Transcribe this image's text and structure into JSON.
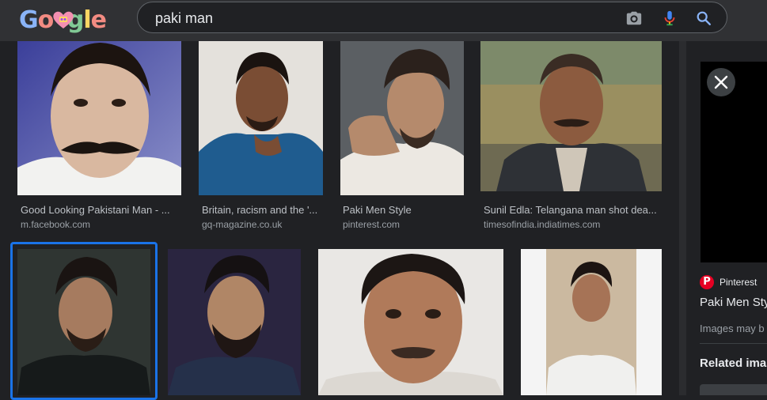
{
  "logo": {
    "letters": [
      "G",
      "o",
      "g",
      "l",
      "e"
    ]
  },
  "search": {
    "query": "paki man"
  },
  "results": [
    {
      "title": "Good Looking Pakistani Man - ...",
      "source": "m.facebook.com"
    },
    {
      "title": "Britain, racism and the '...",
      "source": "gq-magazine.co.uk"
    },
    {
      "title": "Paki Men Style",
      "source": "pinterest.com"
    },
    {
      "title": "Sunil Edla: Telangana man shot dea...",
      "source": "timesofindia.indiatimes.com"
    }
  ],
  "preview": {
    "source_name": "Pinterest",
    "title": "Paki Men Sty",
    "note": "Images may b",
    "related": "Related ima"
  },
  "colors": {
    "background": "#202124",
    "topbar": "#303134",
    "selection": "#1a73e8",
    "pinterest": "#e60023"
  }
}
